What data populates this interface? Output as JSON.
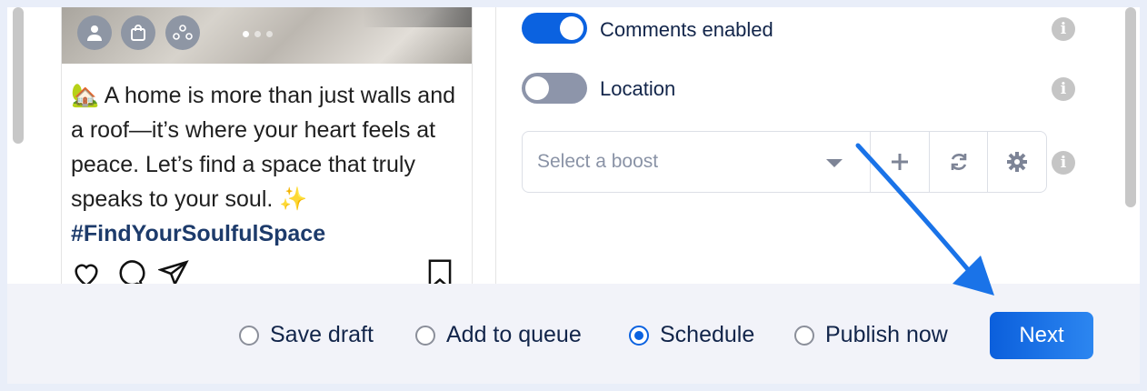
{
  "preview": {
    "caption_emoji": "🏡",
    "caption_text": "A home is more than just walls and a roof—it’s where your heart feels at peace. Let’s find a space that truly speaks to your soul.",
    "caption_sparkle": "✨",
    "hashtag": "#FindYourSoulfulSpace",
    "overlay_icons": [
      "user-icon",
      "shopping-bag-icon",
      "collaborators-icon"
    ],
    "action_icons": [
      "heart-icon",
      "comment-icon",
      "send-icon",
      "bookmark-icon"
    ]
  },
  "settings": {
    "comments": {
      "label": "Comments enabled",
      "enabled": true
    },
    "location": {
      "label": "Location",
      "enabled": false
    },
    "boost": {
      "placeholder": "Select a boost",
      "buttons": [
        "plus-icon",
        "refresh-icon",
        "gear-icon"
      ]
    },
    "info_icon_glyph": "i"
  },
  "footer": {
    "options": [
      {
        "label": "Save draft",
        "checked": false
      },
      {
        "label": "Add to queue",
        "checked": false
      },
      {
        "label": "Schedule",
        "checked": true
      },
      {
        "label": "Publish now",
        "checked": false
      }
    ],
    "next_label": "Next"
  },
  "colors": {
    "accent": "#0b62e0",
    "toggle_off": "#8d95aa",
    "annotation_arrow": "#1a73e8"
  }
}
